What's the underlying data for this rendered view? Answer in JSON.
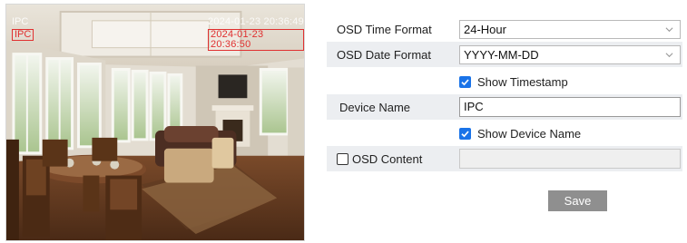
{
  "preview": {
    "osd_device_name": "IPC",
    "osd_device_name_ghost": "IPC",
    "osd_timestamp": "2024-01-23 20:36:50",
    "osd_timestamp_ghost": "2024-01-23 20:36:49"
  },
  "form": {
    "time_format": {
      "label": "OSD Time Format",
      "value": "24-Hour"
    },
    "date_format": {
      "label": "OSD Date Format",
      "value": "YYYY-MM-DD"
    },
    "show_timestamp": {
      "label": "Show Timestamp",
      "checked": true
    },
    "device_name": {
      "label": "Device Name",
      "value": "IPC"
    },
    "show_device_name": {
      "label": "Show Device Name",
      "checked": true
    },
    "osd_content": {
      "label": "OSD Content",
      "checked": false,
      "value": ""
    },
    "save_label": "Save"
  },
  "colors": {
    "accent_checkbox": "#1a73e8",
    "osd_text": "#e03030",
    "save_button": "#8f8f8f",
    "row_shade": "#eceef1"
  },
  "icons": [
    "chevron-down-icon",
    "checkmark-icon"
  ]
}
